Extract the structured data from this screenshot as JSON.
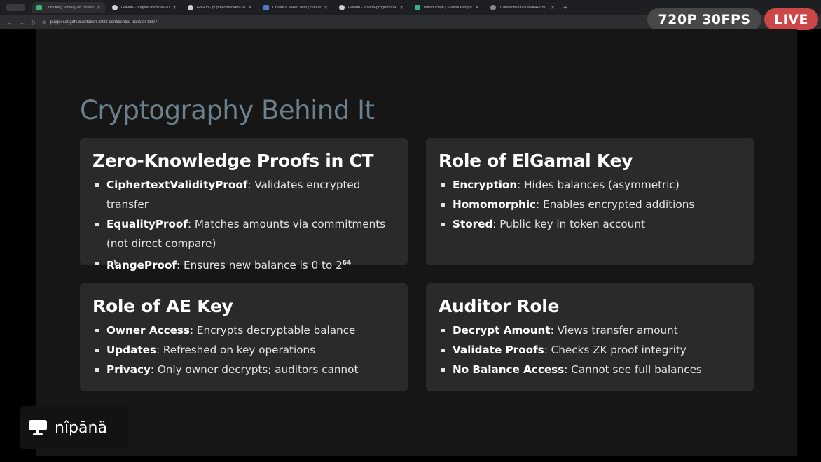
{
  "browser": {
    "tabs": [
      {
        "label": "Unlocking Privacy on Solana",
        "icon": "solana-favicon",
        "active": true
      },
      {
        "label": "GitHub - pupplecat/token-20",
        "icon": "github-favicon",
        "active": false
      },
      {
        "label": "GitHub - pupplecat/token-20",
        "icon": "github-favicon",
        "active": false
      },
      {
        "label": "Create a Token Mint | Solana",
        "icon": "solana-favicon",
        "active": false
      },
      {
        "label": "GitHub - solana-program/tok",
        "icon": "github-favicon",
        "active": false
      },
      {
        "label": "Introduction | Solana Program",
        "icon": "solana-favicon",
        "active": false
      },
      {
        "label": "Transaction 6SLwvK4HcYC",
        "icon": "explorer-favicon",
        "active": false
      }
    ],
    "url": "pupplecat.github.io/token-2022-confidential-transfer-talk/7"
  },
  "stream": {
    "quality": "720P 30FPS",
    "live": "LIVE"
  },
  "slide": {
    "title": "Cryptography Behind It",
    "cards": [
      {
        "title": "Zero-Knowledge Proofs in CT",
        "items": [
          {
            "term": "CiphertextValidityProof",
            "text": ": Validates encrypted transfer"
          },
          {
            "term": "EqualityProof",
            "text": ": Matches amounts via commitments (not direct compare)"
          },
          {
            "term": "RangeProof",
            "text": ": Ensures new balance is 0 to 2",
            "sup": "64"
          }
        ]
      },
      {
        "title": "Role of ElGamal Key",
        "items": [
          {
            "term": "Encryption",
            "text": ": Hides balances (asymmetric)"
          },
          {
            "term": "Homomorphic",
            "text": ": Enables encrypted additions"
          },
          {
            "term": "Stored",
            "text": ": Public key in token account"
          }
        ]
      },
      {
        "title": "Role of AE Key",
        "items": [
          {
            "term": "Owner Access",
            "text": ": Encrypts decryptable balance"
          },
          {
            "term": "Updates",
            "text": ": Refreshed on key operations"
          },
          {
            "term": "Privacy",
            "text": ": Only owner decrypts; auditors cannot"
          }
        ]
      },
      {
        "title": "Auditor Role",
        "items": [
          {
            "term": "Decrypt Amount",
            "text": ": Views transfer amount"
          },
          {
            "term": "Validate Proofs",
            "text": ": Checks ZK proof integrity"
          },
          {
            "term": "No Balance Access",
            "text": ": Cannot see full balances"
          }
        ]
      }
    ]
  },
  "presenter": {
    "name": "nîpānä",
    "icon": "presentation-screen-icon"
  }
}
